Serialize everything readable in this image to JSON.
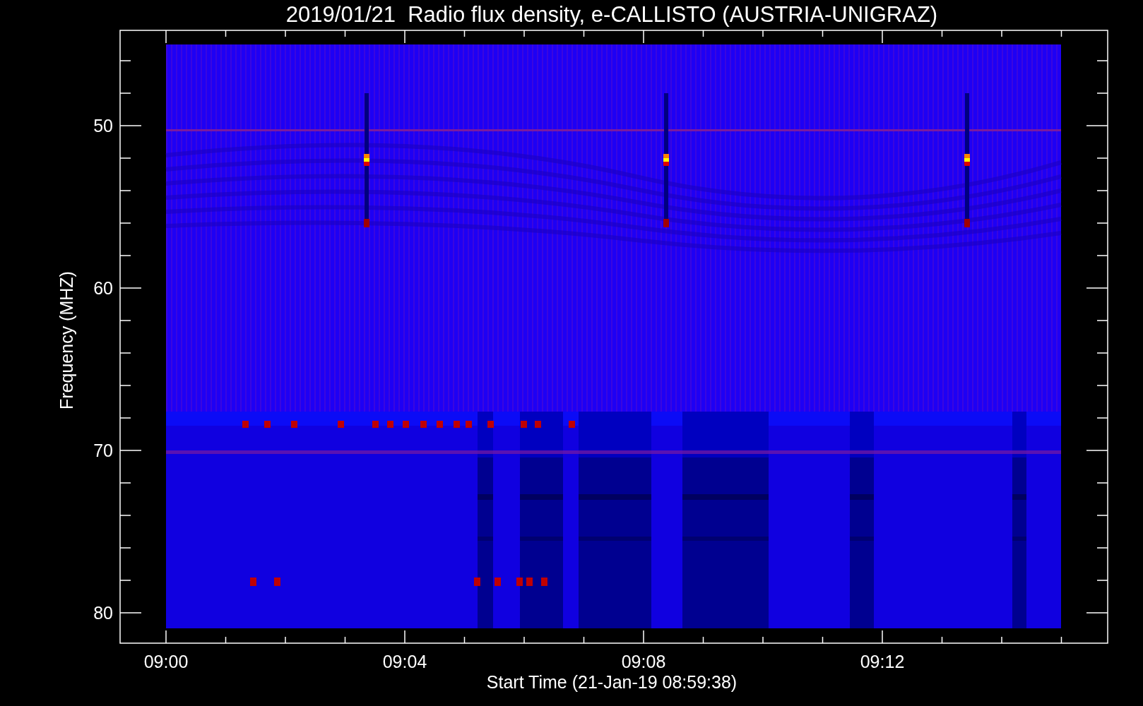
{
  "title": "2019/01/21  Radio flux density, e-CALLISTO (AUSTRIA-UNIGRAZ)",
  "x_axis": {
    "label": "Start Time (21-Jan-19 08:59:38)",
    "ticks": [
      "09:00",
      "09:04",
      "09:08",
      "09:12"
    ]
  },
  "y_axis": {
    "label": "Frequency (MHZ)",
    "ticks": [
      "50",
      "60",
      "70",
      "80"
    ]
  }
}
